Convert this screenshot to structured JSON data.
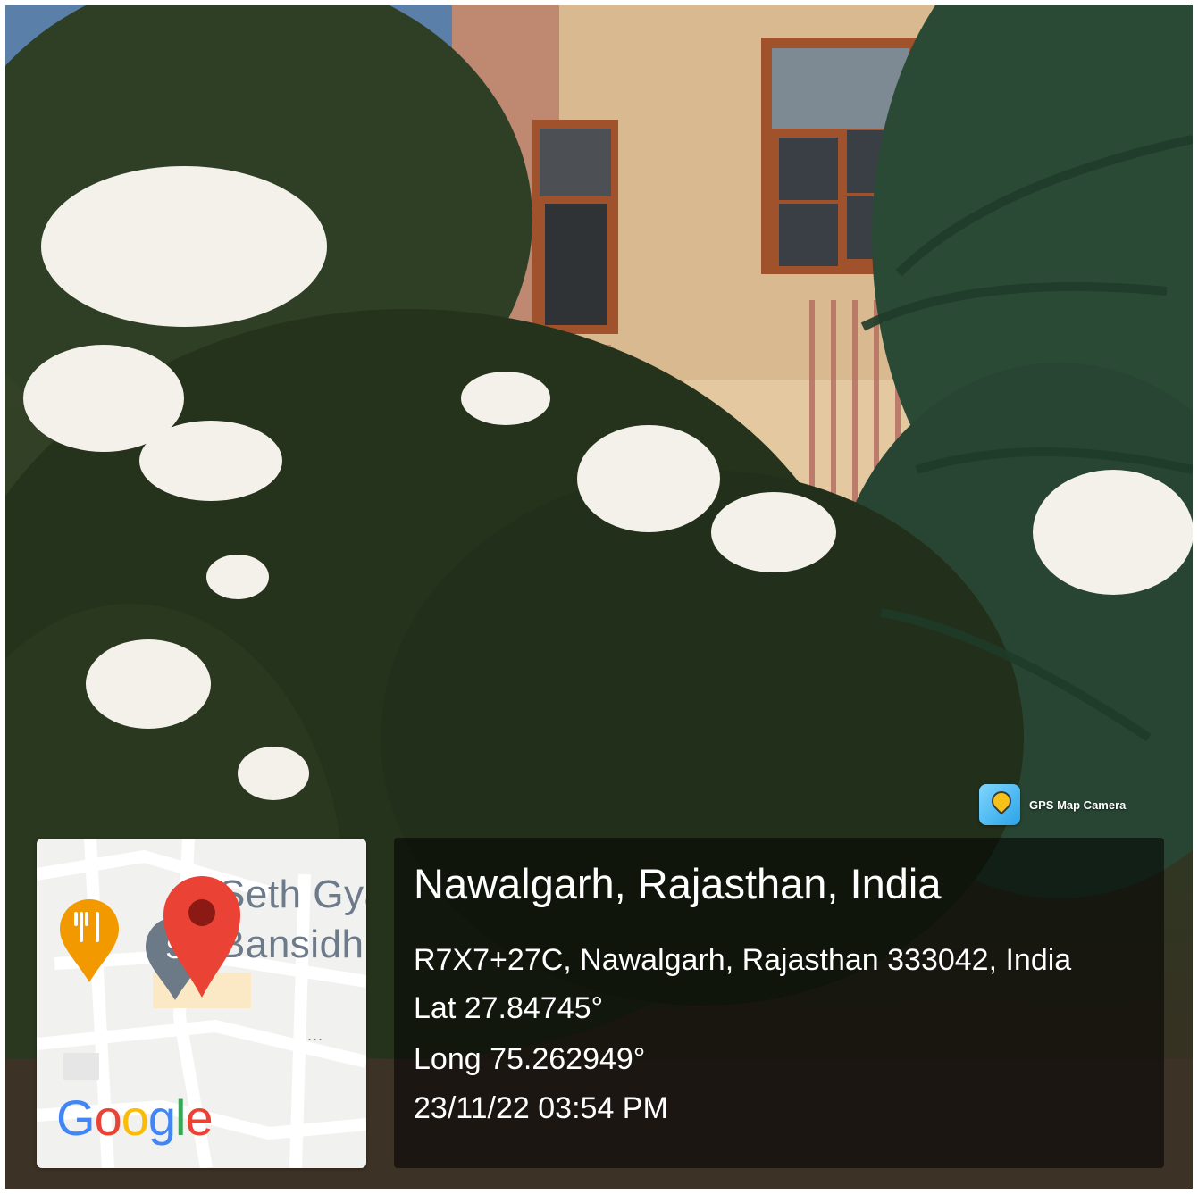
{
  "overlay": {
    "app_name": "GPS Map Camera",
    "location_title": "Nawalgarh, Rajasthan, India",
    "address": "R7X7+27C, Nawalgarh, Rajasthan 333042, India",
    "latitude": "Lat 27.84745°",
    "longitude": "Long 75.262949°",
    "datetime": "23/11/22 03:54 PM"
  },
  "map": {
    "place_line1": "Seth Gya",
    "place_line2": "Bansidh",
    "more": "...",
    "logo": [
      "G",
      "o",
      "o",
      "g",
      "l",
      "e"
    ],
    "marker_color": "#EA4335",
    "restaurant_icon": "restaurant-fork-knife-icon",
    "restaurant_color": "#F29900",
    "poi_icon": "school-poi-icon"
  },
  "colors": {
    "panel_bg": "rgba(0,0,0,0.55)",
    "text": "#ffffff"
  }
}
